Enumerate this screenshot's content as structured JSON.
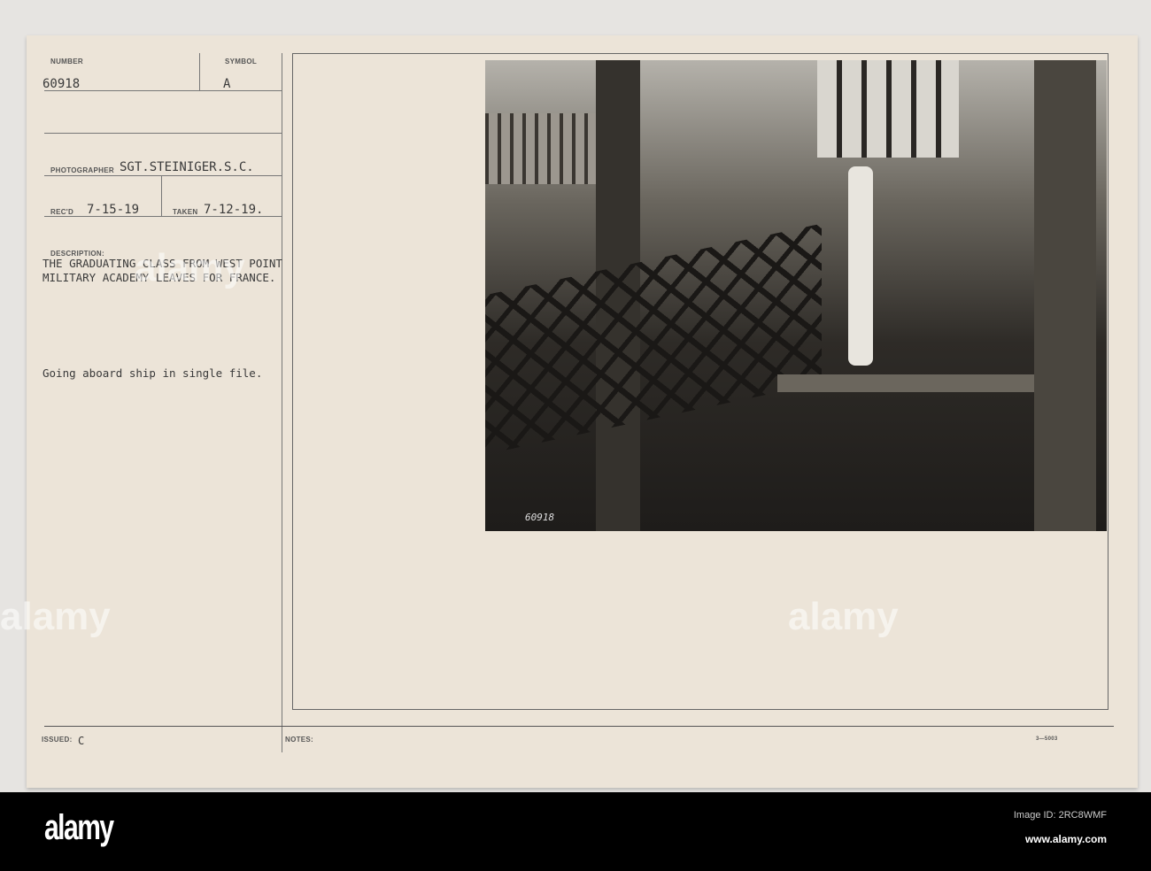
{
  "card": {
    "number_label": "NUMBER",
    "number": "60918",
    "symbol_label": "SYMBOL",
    "symbol": "A",
    "photographer_label": "PHOTOGRAPHER",
    "photographer": "SGT.STEINIGER.S.C.",
    "recd_label": "REC'D",
    "recd": "7-15-19",
    "taken_label": "TAKEN",
    "taken": "7-12-19.",
    "description_label": "DESCRIPTION:",
    "description": "THE GRADUATING CLASS FROM WEST POINT MILITARY ACADEMY LEAVES FOR FRANCE.",
    "caption": "Going aboard ship in single file.",
    "issued_label": "ISSUED:",
    "issued": "C",
    "notes_label": "NOTES:",
    "form_code": "3—5003"
  },
  "photo": {
    "negative_number": "60918"
  },
  "watermark": {
    "text": "alamy"
  },
  "footer": {
    "logo": "alamy",
    "image_id": "Image ID: 2RC8WMF",
    "url": "www.alamy.com"
  }
}
